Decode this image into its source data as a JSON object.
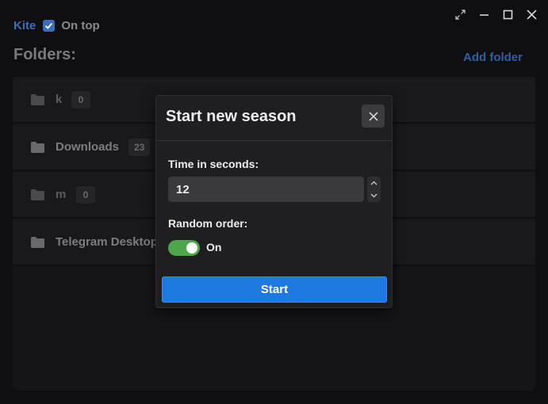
{
  "app": {
    "name": "Kite",
    "on_top_label": "On top",
    "on_top_checked": true
  },
  "window_controls": [
    "resize-icon",
    "minimize-icon",
    "maximize-icon",
    "close-icon"
  ],
  "folders": {
    "title": "Folders:",
    "add_label": "Add folder",
    "items": [
      {
        "name": "k",
        "count": "0"
      },
      {
        "name": "Downloads",
        "count": "23"
      },
      {
        "name": "m",
        "count": "0"
      },
      {
        "name": "Telegram Desktop",
        "count": ""
      }
    ]
  },
  "dialog": {
    "title": "Start new season",
    "time_label": "Time in seconds:",
    "time_value": "12",
    "random_label": "Random order:",
    "random_on": true,
    "random_state_text": "On",
    "start_label": "Start"
  },
  "colors": {
    "accent": "#1f78e0",
    "toggle_on": "#4ea54a",
    "link": "#2f5f9e"
  }
}
